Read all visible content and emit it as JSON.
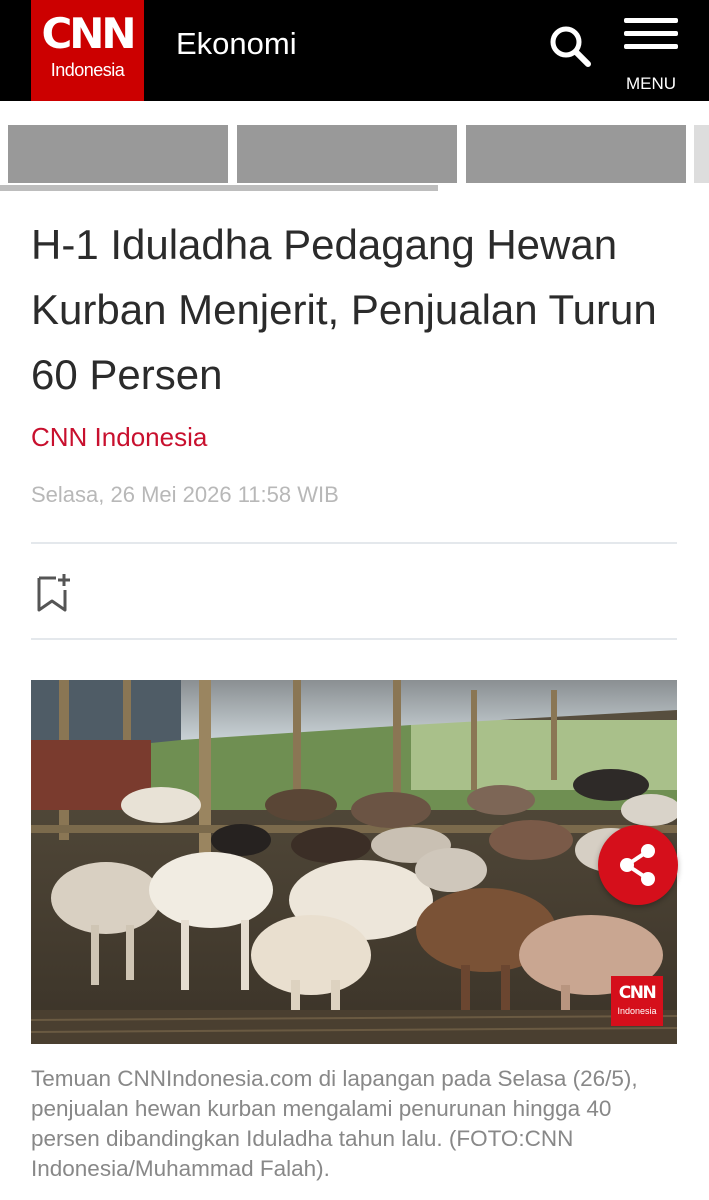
{
  "header": {
    "logo_text": "CNN",
    "logo_subtext": "Indonesia",
    "section": "Ekonomi",
    "search_icon": "search-icon",
    "menu_icon": "hamburger-icon",
    "menu_label": "MENU",
    "brand_color": "#cc0000"
  },
  "article": {
    "title": "H-1 Iduladha Pedagang Hewan Kurban Menjerit, Penjualan Turun 60 Persen",
    "author": "CNN Indonesia",
    "date": "Selasa, 26 Mei 2026 11:58 WIB",
    "bookmark_icon": "bookmark-add-icon",
    "share_icon": "share-icon",
    "photo_watermark": {
      "text": "CNN",
      "subtext": "Indonesia"
    },
    "caption": "Temuan CNNIndonesia.com di lapangan pada Selasa (26/5), penjualan hewan kurban mengalami penurunan hingga 40 persen dibandingkan Iduladha tahun lalu. (FOTO:CNN Indonesia/Muhammad Falah)."
  },
  "colors": {
    "accent": "#c8102e",
    "header_bg": "#000000",
    "date_text": "#b8b8b8",
    "caption_text": "#888888"
  }
}
